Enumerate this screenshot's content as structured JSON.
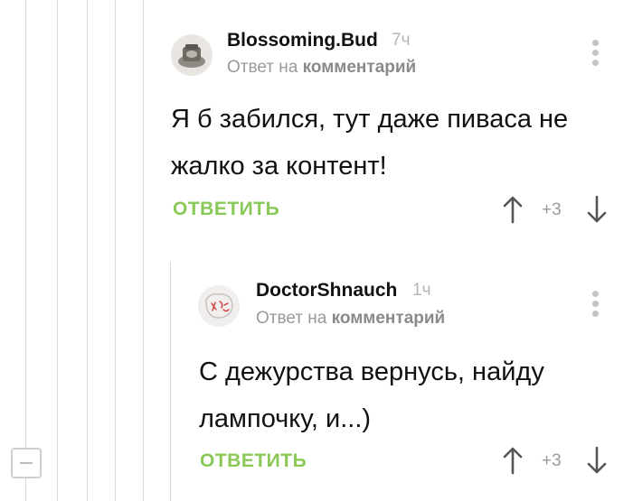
{
  "comments": [
    {
      "username": "Blossoming.Bud",
      "time": "7ч",
      "reply_prefix": "Ответ на",
      "reply_link": "комментарий",
      "text": "Я б забился, тут даже пиваса не жалко за контент!",
      "reply_label": "ОТВЕТИТЬ",
      "rating": "+3"
    },
    {
      "username": "DoctorShnauch",
      "time": "1ч",
      "reply_prefix": "Ответ на",
      "reply_link": "комментарий",
      "text": "С дежурства вернусь, найду лампочку, и...)",
      "reply_label": "ОТВЕТИТЬ",
      "rating": "+3"
    }
  ],
  "colors": {
    "accent": "#8ac858",
    "thread_line": "#d9d9d9",
    "muted": "#9a9a9a"
  },
  "icons": [
    "collapse-thread-icon",
    "more-icon",
    "arrow-up-icon",
    "arrow-down-icon"
  ]
}
